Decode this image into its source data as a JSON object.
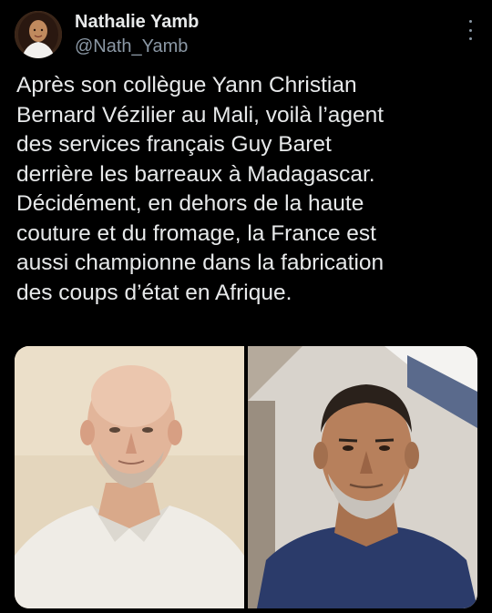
{
  "tweet": {
    "author": {
      "display_name": "Nathalie Yamb",
      "handle": "@Nath_Yamb",
      "avatar_icon": "profile-avatar"
    },
    "more_icon": "more-vertical-icon",
    "text_lines": [
      "Après son collègue Yann Christian",
      "Bernard Vézilier au Mali, voilà l’agent",
      "des services français Guy Baret",
      "derrière les barreaux à Madagascar.",
      "Décidément, en dehors de la haute",
      "couture et du fromage, la France est",
      "aussi championne dans la fabrication",
      "des coups d’état en Afrique."
    ],
    "media": [
      {
        "kind": "photo"
      },
      {
        "kind": "photo"
      }
    ]
  },
  "colors": {
    "background": "#000000",
    "primary_text": "#e7e9ea",
    "secondary_text": "#8b98a5"
  }
}
